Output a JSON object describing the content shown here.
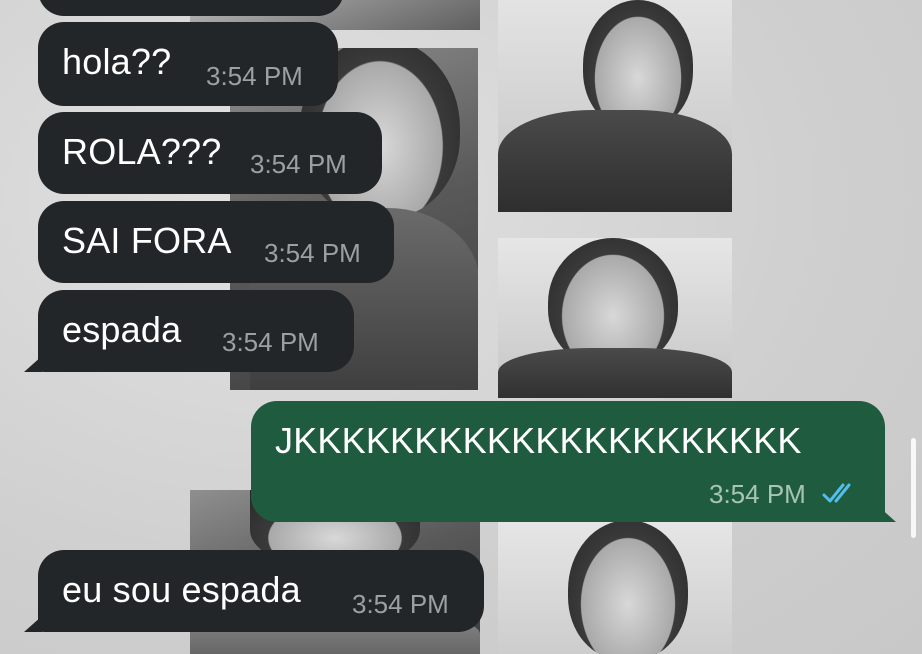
{
  "chat": {
    "messages": [
      {
        "direction": "incoming",
        "text": "hola??",
        "time": "3:54 PM"
      },
      {
        "direction": "incoming",
        "text": "ROLA???",
        "time": "3:54 PM"
      },
      {
        "direction": "incoming",
        "text": "SAI FORA",
        "time": "3:54 PM"
      },
      {
        "direction": "incoming",
        "text": "espada",
        "time": "3:54 PM"
      },
      {
        "direction": "outgoing",
        "text": "JKKKKKKKKKKKKKKKKKKKKK",
        "time": "3:54 PM",
        "status": "read"
      },
      {
        "direction": "incoming",
        "text": "eu sou espada",
        "time": "3:54 PM"
      }
    ]
  },
  "colors": {
    "incoming_bubble": "#232628",
    "outgoing_bubble": "#1f5c3f",
    "read_ticks": "#53bdeb",
    "timestamp": "#9aa0a3"
  },
  "icons": {
    "read_receipt": "double-check-icon"
  }
}
